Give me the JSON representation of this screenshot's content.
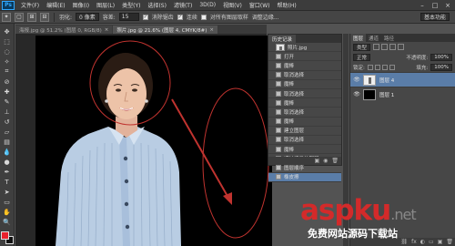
{
  "app": {
    "logo": "Ps"
  },
  "menu": [
    "文件(F)",
    "编辑(E)",
    "图像(I)",
    "图层(L)",
    "类型(Y)",
    "选择(S)",
    "滤镜(T)",
    "3D(D)",
    "视图(V)",
    "窗口(W)",
    "帮助(H)"
  ],
  "window_controls": [
    "–",
    "□",
    "×"
  ],
  "options_bar": {
    "feather_label": "羽化:",
    "feather_value": "0 像素",
    "antialias_label": "消除锯齿",
    "style_label": "样式:",
    "style_value": "正常",
    "width_label": "宽度:",
    "height_label": "高度:",
    "refine_edge_label": "调整边缘...",
    "mode_select": "基本功能",
    "tolerance_label": "容差:",
    "tolerance_value": "15",
    "contiguous_label": "连续",
    "sample_all_label": "对所有图层取样"
  },
  "document": {
    "tab_label": "海报.jpg @ 51.2% (图层 0, RGB/8)",
    "second_tab_label": "照片.jpg @ 21.6% (图层 4, CMYK/8#)"
  },
  "colors": {
    "foreground": "#e8212c",
    "background": "#111111",
    "annotation_red": "#c0332f",
    "selection_blue": "#5a7da8"
  },
  "history": {
    "tab_label": "历史记录",
    "snapshot_name": "照片.jpg",
    "items": [
      "打开",
      "魔棒",
      "取消选择",
      "魔棒",
      "取消选择",
      "魔棒",
      "取消选择",
      "魔棒",
      "建立图层",
      "取消选择",
      "魔棒",
      "通过拷贝的图层",
      "图层顺序",
      "橡皮擦"
    ],
    "selected_index": 13
  },
  "layers": {
    "tabs": [
      "图层",
      "通道",
      "路径"
    ],
    "kind_label": "类型",
    "blend_mode": "正常",
    "opacity_label": "不透明度:",
    "opacity_value": "100%",
    "lock_label": "锁定:",
    "fill_label": "填充:",
    "fill_value": "100%",
    "items": [
      {
        "name": "图层 4",
        "thumb": "white",
        "selected": true
      },
      {
        "name": "图层 1",
        "thumb": "black",
        "selected": false
      }
    ]
  },
  "watermark": {
    "brand": "aspku",
    "suffix": ".net",
    "slogan": "免费网站源码下载站"
  }
}
